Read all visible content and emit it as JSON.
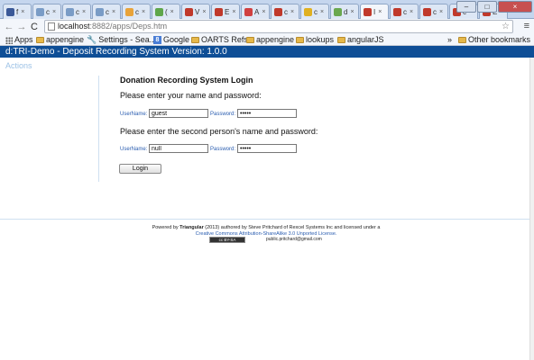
{
  "browser": {
    "tabs": [
      {
        "label": "f",
        "favicon_color": "#3b5998"
      },
      {
        "label": "c",
        "favicon_color": "#7a9cc6"
      },
      {
        "label": "c",
        "favicon_color": "#7a9cc6"
      },
      {
        "label": "c",
        "favicon_color": "#7a9cc6"
      },
      {
        "label": "c",
        "favicon_color": "#e8a33a"
      },
      {
        "label": "(",
        "favicon_color": "#5fa64a"
      },
      {
        "label": "V",
        "favicon_color": "#c0392b"
      },
      {
        "label": "E",
        "favicon_color": "#c0392b"
      },
      {
        "label": "A",
        "favicon_color": "#d04040"
      },
      {
        "label": "c",
        "favicon_color": "#c0392b"
      },
      {
        "label": "c",
        "favicon_color": "#e0b020"
      },
      {
        "label": "d",
        "favicon_color": "#6aa84f"
      },
      {
        "label": "I",
        "favicon_color": "#c0392b"
      },
      {
        "label": "c",
        "favicon_color": "#c0392b"
      },
      {
        "label": "c",
        "favicon_color": "#c0392b"
      },
      {
        "label": "c",
        "favicon_color": "#c0392b"
      },
      {
        "label": "E",
        "favicon_color": "#c0392b"
      }
    ],
    "tab_close_glyph": "×",
    "window_buttons": {
      "minimize": "–",
      "maximize": "□",
      "close": "×"
    },
    "nav": {
      "back": "←",
      "forward": "→",
      "reload": "C"
    },
    "url_host": "localhost",
    "url_rest": ":8882/apps/Deps.htm",
    "star_glyph": "☆",
    "menu_glyph": "≡",
    "bookmarks": [
      {
        "label": "Apps",
        "icon": "apps-icon"
      },
      {
        "label": "appengine",
        "icon": "folder-icon"
      },
      {
        "label": "Settings - Sea...",
        "icon": "wrench-icon"
      },
      {
        "label": "Google",
        "icon": "google-icon"
      },
      {
        "label": "OARTS Refs",
        "icon": "folder-icon"
      },
      {
        "label": "appengine",
        "icon": "folder-icon"
      },
      {
        "label": "lookups",
        "icon": "folder-icon"
      },
      {
        "label": "angularJS",
        "icon": "folder-icon"
      }
    ],
    "bookmarks_overflow": "»",
    "other_bookmarks": "Other bookmarks"
  },
  "app": {
    "header": "d:TRI-Demo - Deposit Recording System Version: 1.0.0",
    "actions_link": "Actions"
  },
  "login": {
    "title": "Donation Recording System Login",
    "prompt1": "Please enter your name and password:",
    "prompt2": "Please enter the second person's name and password:",
    "username_label": "UserName:",
    "password_label": "Password:",
    "user1_value": "guest",
    "pass1_value": "•••••",
    "user2_value": "null",
    "pass2_value": "•••••",
    "button_label": "Login"
  },
  "footer": {
    "powered_by": "Powered by",
    "product": "Triangular",
    "line1_rest": "(2013) authored by Steve Pritchard of Rexcel Systems Inc and licensed under a",
    "license_link": "Creative Commons Attribution-ShareAlike 3.0 Unported License.",
    "cc_badge": "cc BY-SA",
    "email": "public.pritchard@gmail.com"
  },
  "colors": {
    "header_bg": "#0e4e96",
    "actions_link": "#9dc2e6",
    "field_label": "#2a5db0"
  }
}
